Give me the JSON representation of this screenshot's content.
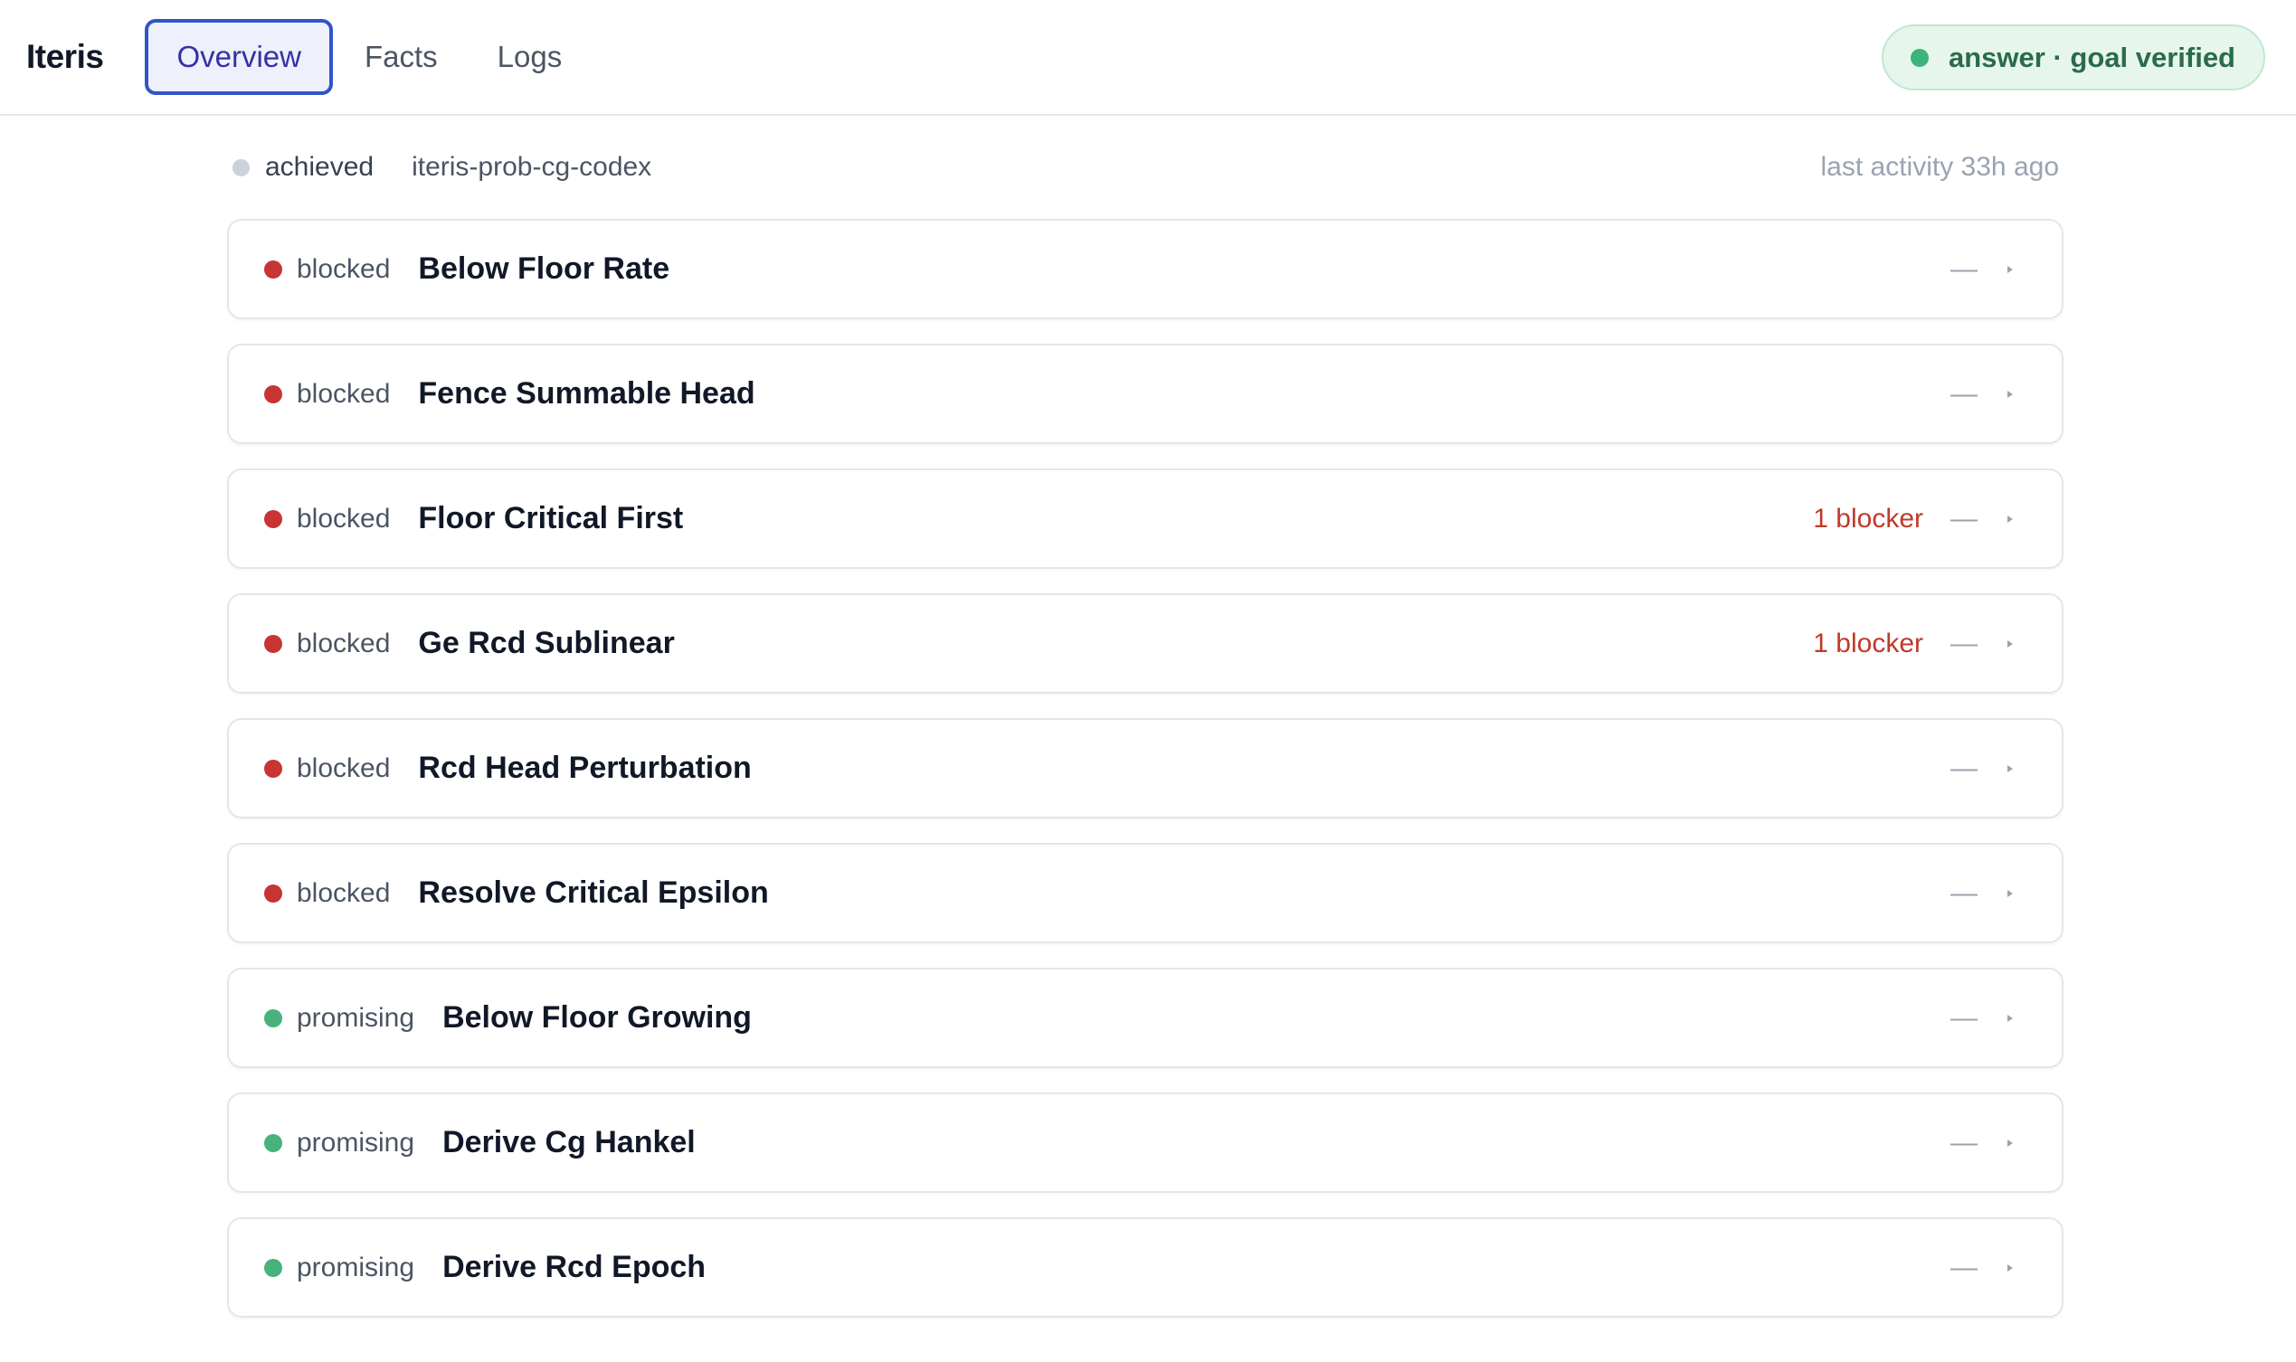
{
  "app": {
    "brand": "Iteris"
  },
  "tabs": [
    {
      "label": "Overview",
      "active": true
    },
    {
      "label": "Facts",
      "active": false
    },
    {
      "label": "Logs",
      "active": false
    }
  ],
  "status_pill": {
    "text": "answer · goal verified",
    "color": "#3cb47a"
  },
  "meta": {
    "state": "achieved",
    "id": "iteris-prob-cg-codex",
    "activity": "last activity 33h ago"
  },
  "nodes": [
    {
      "state": "blocked",
      "title": "Below Floor Rate",
      "blocker": "",
      "dash": "—"
    },
    {
      "state": "blocked",
      "title": "Fence Summable Head",
      "blocker": "",
      "dash": "—"
    },
    {
      "state": "blocked",
      "title": "Floor Critical First",
      "blocker": "1 blocker",
      "dash": "—"
    },
    {
      "state": "blocked",
      "title": "Ge Rcd Sublinear",
      "blocker": "1 blocker",
      "dash": "—"
    },
    {
      "state": "blocked",
      "title": "Rcd Head Perturbation",
      "blocker": "",
      "dash": "—"
    },
    {
      "state": "blocked",
      "title": "Resolve Critical Epsilon",
      "blocker": "",
      "dash": "—"
    },
    {
      "state": "promising",
      "title": "Below Floor Growing",
      "blocker": "",
      "dash": "—"
    },
    {
      "state": "promising",
      "title": "Derive Cg Hankel",
      "blocker": "",
      "dash": "—"
    },
    {
      "state": "promising",
      "title": "Derive Rcd Epoch",
      "blocker": "",
      "dash": "—"
    }
  ],
  "colors": {
    "blocked": "#c83434",
    "promising": "#47b27c",
    "accent": "#2f55c9"
  }
}
